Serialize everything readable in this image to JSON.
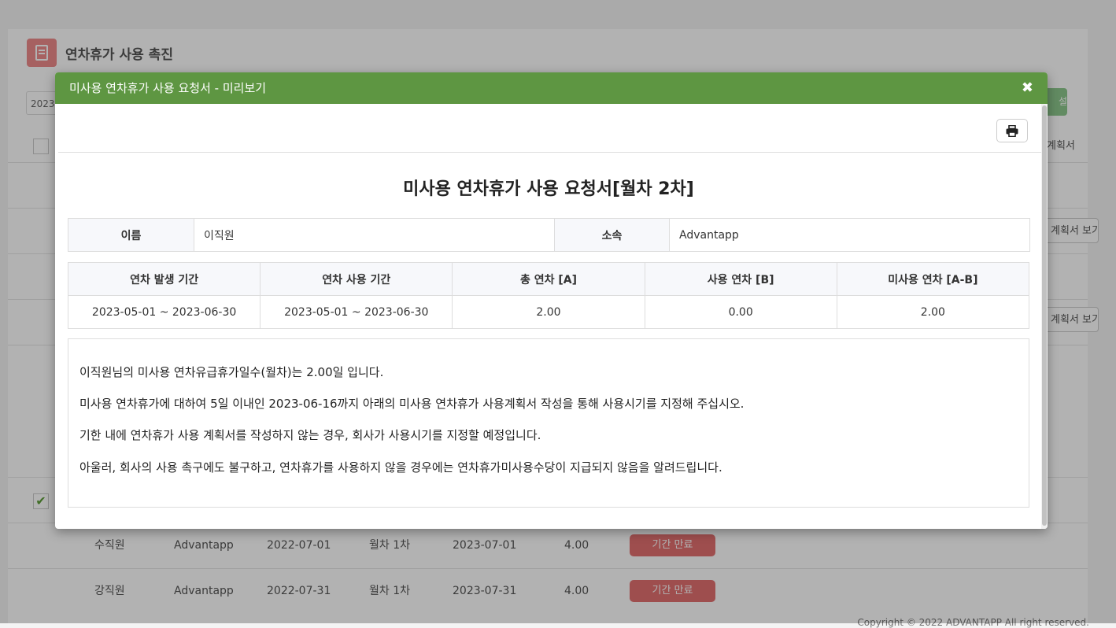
{
  "background": {
    "page_title": "연차휴가 사용 촉진",
    "filter_date": "2023",
    "top_button": "설",
    "plan_column_header": "계획서",
    "plan_button_label": "계획서 보기",
    "rows": [
      {
        "name": "수직원",
        "company": "Advantapp",
        "join_date": "2022-07-01",
        "type": "월차 1차",
        "due_date": "2023-07-01",
        "days": "4.00",
        "status": "기간 만료"
      },
      {
        "name": "강직원",
        "company": "Advantapp",
        "join_date": "2022-07-31",
        "type": "월차 1차",
        "due_date": "2023-07-31",
        "days": "4.00",
        "status": "기간 만료"
      }
    ],
    "copyright": "Copyright © 2022 ADVANTAPP All right reserved."
  },
  "modal": {
    "title": "미사용 연차휴가 사용 요청서 - 미리보기",
    "close_icon": "✖",
    "print_icon": "print-icon"
  },
  "document": {
    "title": "미사용 연차휴가 사용 요청서[월차 2차]",
    "info": {
      "name_label": "이름",
      "name_value": "이직원",
      "dept_label": "소속",
      "dept_value": "Advantapp"
    },
    "stats": {
      "headers": [
        "연차 발생 기간",
        "연차 사용 기간",
        "총 연차 [A]",
        "사용 연차 [B]",
        "미사용 연차 [A-B]"
      ],
      "values": [
        "2023-05-01 ~ 2023-06-30",
        "2023-05-01 ~ 2023-06-30",
        "2.00",
        "0.00",
        "2.00"
      ]
    },
    "paragraphs": [
      "이직원님의 미사용 연차유급휴가일수(월차)는 2.00일 입니다.",
      "미사용 연차휴가에 대하여 5일 이내인 2023-06-16까지 아래의 미사용 연차휴가 사용계획서 작성을 통해 사용시기를 지정해 주십시오.",
      "기한 내에 연차휴가 사용 계획서를 작성하지 않는 경우, 회사가 사용시기를 지정할 예정입니다.",
      "아울러, 회사의 사용 촉구에도 불구하고, 연차휴가를 사용하지 않을 경우에는 연차휴가미사용수당이 지급되지 않음을 알려드립니다."
    ]
  }
}
